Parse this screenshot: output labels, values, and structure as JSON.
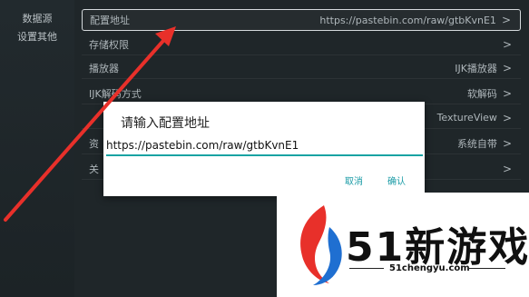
{
  "sidebar": {
    "items": [
      {
        "label": "数据源"
      },
      {
        "label": "设置其他"
      }
    ]
  },
  "settings": {
    "rows": [
      {
        "label": "配置地址",
        "value": "https://pastebin.com/raw/gtbKvnE1"
      },
      {
        "label": "存储权限",
        "value": ""
      },
      {
        "label": "播放器",
        "value": "IJK播放器"
      },
      {
        "label": "IJK解码方式",
        "value": "软解码"
      },
      {
        "label": "",
        "value": "TextureView"
      },
      {
        "label": "资",
        "value": "系统自带"
      },
      {
        "label": "关",
        "value": ""
      }
    ]
  },
  "dialog": {
    "title": "请输入配置地址",
    "input_value": "https://pastebin.com/raw/gtbKvnE1",
    "cancel_label": "取消",
    "confirm_label": "确认"
  },
  "watermark": {
    "brand": "51新游戏",
    "url": "51chengyu.com"
  },
  "colors": {
    "accent": "#1a9ba6",
    "arrow": "#e8302a",
    "logo_red": "#e8302a",
    "logo_blue": "#1f6fd1"
  },
  "icons": {
    "row_chevron": "chevron-right-icon",
    "annotation": "red-arrow-annotation"
  }
}
